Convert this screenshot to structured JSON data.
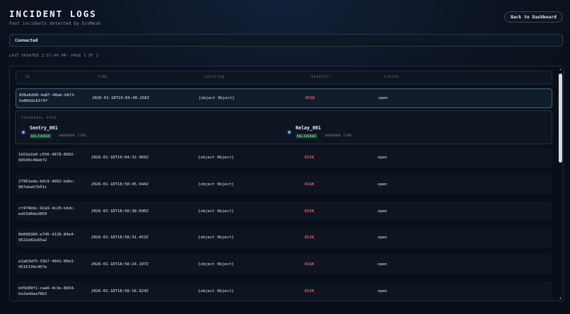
{
  "header": {
    "title": "INCIDENT LOGS",
    "subtitle": "Past incidents detected by EcoMesh",
    "back_label": "Back to Dashboard"
  },
  "connection": {
    "status": "Connected"
  },
  "meta": {
    "updated": "LAST UPDATED 1:37:46 PM- PAGE 1 OF 2"
  },
  "table": {
    "columns": [
      "ID",
      "TIME",
      "LOCATION",
      "SEVERITY",
      "STATUS"
    ],
    "rows": [
      {
        "id": "836a6d98-4a87-48ab-b8f3-5a80ddcb1f9f",
        "time": "2026-01-18T19:04:40.258Z",
        "location": "[object Object]",
        "severity": "HIGH",
        "status": "open"
      },
      {
        "id": "1b51e2a0-c556-4678-8992-94549c46ebf2",
        "time": "2026-01-18T19:04:32.969Z",
        "location": "[object Object]",
        "severity": "HIGH",
        "status": "open"
      },
      {
        "id": "27961ede-b9c9-4992-bdbc-967aba57b51c",
        "time": "2026-01-18T18:58:45.944Z",
        "location": "[object Object]",
        "severity": "HIGH",
        "status": "open"
      },
      {
        "id": "cf474b9c-92a9-4c20-b4dc-ea53d6de2859",
        "time": "2026-01-18T18:58:38.690Z",
        "location": "[object Object]",
        "severity": "HIGH",
        "status": "open"
      },
      {
        "id": "8b608389-e745-4126-84e4-9522e82a55a2",
        "time": "2026-01-18T18:58:31.453Z",
        "location": "[object Object]",
        "severity": "HIGH",
        "status": "open"
      },
      {
        "id": "e1a63df5-33b7-4941-80e3-4516139c457e",
        "time": "2026-01-18T18:58:24.197Z",
        "location": "[object Object]",
        "severity": "HIGH",
        "status": "open"
      },
      {
        "id": "b45b09f1-caa6-4c3e-8b54-be2addaa78b2",
        "time": "2026-01-18T18:58:16.924Z",
        "location": "[object Object]",
        "severity": "HIGH",
        "status": "open"
      }
    ]
  },
  "traversal": {
    "label": "TRAVERSAL PATH",
    "nodes": [
      {
        "name": "Sentry_001",
        "badge": "DELIVERED",
        "time": "UNKNOWN TIME"
      },
      {
        "name": "Relay_001",
        "badge": "DELIVERED",
        "time": "UNKNOWN TIME"
      }
    ]
  },
  "colors": {
    "severity_high": "#ff5e6e",
    "delivered": "#7fe0a8",
    "node": "#6fa8ff"
  }
}
